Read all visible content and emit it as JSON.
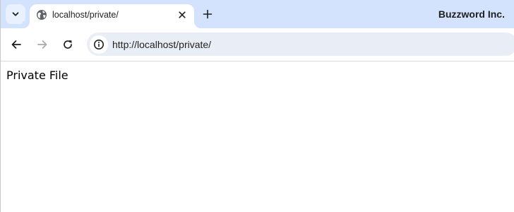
{
  "browser": {
    "tab": {
      "title": "localhost/private/",
      "favicon": "globe-icon"
    },
    "profile_name": "Buzzword Inc.",
    "toolbar": {
      "url": "http://localhost/private/",
      "back_enabled": true,
      "forward_enabled": false
    }
  },
  "page": {
    "body_text": "Private File"
  },
  "colors": {
    "tabstrip_bg": "#d3e3fd",
    "omnibox_bg": "#e9eef6",
    "icon_color": "#1f1f1f",
    "disabled_icon_color": "#a8a8a8"
  }
}
